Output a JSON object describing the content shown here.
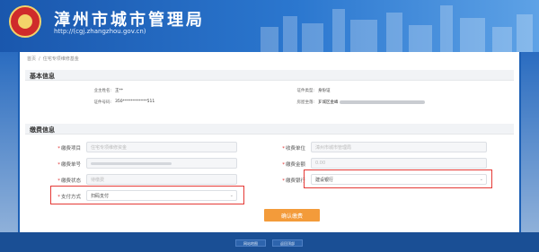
{
  "header": {
    "title": "漳州市城市管理局",
    "url": "http://(cgj.zhangzhou.gov.cn)"
  },
  "breadcrumb": {
    "home": "首页",
    "current": "住宅专项维修基金"
  },
  "basic_info": {
    "heading": "基本信息",
    "rows": [
      {
        "label": "业主姓名:",
        "value": "王**"
      },
      {
        "label": "证件类型:",
        "value": "身份证"
      },
      {
        "label": "证件号码:",
        "value": "350************511"
      },
      {
        "label": "房屋坐落:",
        "value": "芗城区金峰"
      }
    ]
  },
  "payment_info": {
    "heading": "缴费信息",
    "fields": [
      {
        "label": "缴费项目",
        "value": "住宅专项维修资金",
        "active": false
      },
      {
        "label": "收费单位",
        "value": "漳州市城市管理局",
        "active": false
      },
      {
        "label": "缴费单号",
        "value": "",
        "active": false
      },
      {
        "label": "缴费金额",
        "value": "0.00",
        "active": false
      },
      {
        "label": "缴费状态",
        "value": "待缴费",
        "active": false
      },
      {
        "label": "缴费银行",
        "value": "建设银行",
        "active": true
      },
      {
        "label": "支付方式",
        "value": "扫码支付",
        "active": true
      }
    ]
  },
  "actions": {
    "confirm_label": "确认缴费"
  },
  "footer": {
    "links": [
      "网站地图",
      "返回顶部"
    ]
  },
  "colors": {
    "banner": "#1a57ad",
    "accent_button": "#f39b3a",
    "highlight_box": "#e53935",
    "required_mark": "#e03131"
  }
}
